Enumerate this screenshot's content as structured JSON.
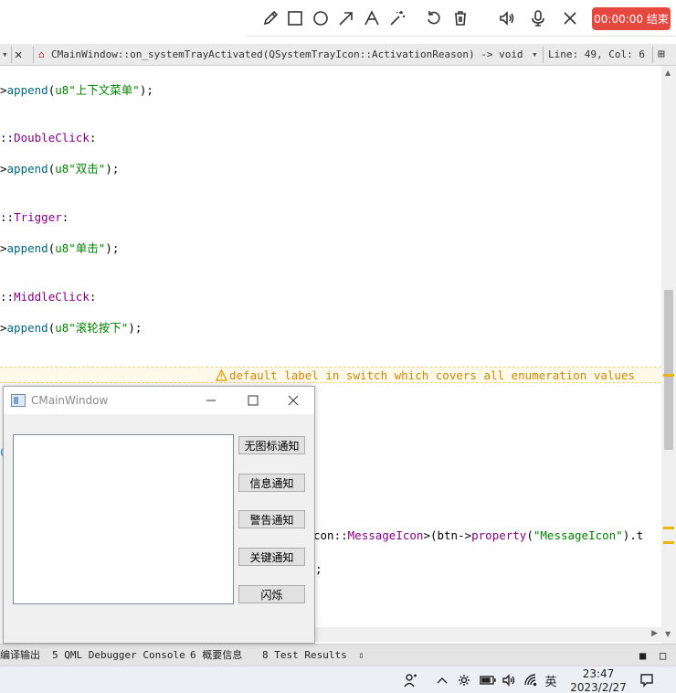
{
  "recorder": {
    "tools": [
      "pencil-icon",
      "rectangle-icon",
      "circle-icon",
      "arrow-icon",
      "text-icon",
      "magic-wand-icon",
      "undo-icon",
      "trash-icon",
      "speaker-icon",
      "microphone-icon",
      "close-icon"
    ],
    "timer_label": "00:00:00 结束",
    "timer_color": "#e5483f"
  },
  "editor_header": {
    "function_signature": "CMainWindow::on_systemTrayActivated(QSystemTrayIcon::ActivationReason) -> void",
    "cursor_position": "Line: 49, Col: 6"
  },
  "code": {
    "lines": [
      {
        "prefix": ">",
        "call": "append",
        "open": "(",
        "string": "u8\"上下文菜单\"",
        "close": ");"
      },
      {
        "scope": "::",
        "enum": "DoubleClick",
        "tail": ":"
      },
      {
        "prefix": ">",
        "call": "append",
        "open": "(",
        "string": "u8\"双击\"",
        "close": ");"
      },
      {
        "scope": "::",
        "enum": "Trigger",
        "tail": ":"
      },
      {
        "prefix": ">",
        "call": "append",
        "open": "(",
        "string": "u8\"单击\"",
        "close": ");"
      },
      {
        "scope": "::",
        "enum": "MiddleClick",
        "tail": ":"
      },
      {
        "prefix": ">",
        "call": "append",
        "open": "(",
        "string": "u8\"滚轮按下\"",
        "close": ");"
      }
    ],
    "warning": "default label in switch which covers all enumeration values",
    "partial_line": {
      "before": "con::",
      "enum": "MessageIcon",
      "mid": ">(btn->",
      "call": "property",
      "string": "\"MessageIcon\"",
      "after": ").t"
    },
    "partial_semicolon": ";"
  },
  "panel": {
    "tabs": [
      {
        "number": "",
        "label": "编译输出"
      },
      {
        "number": "5",
        "label": "QML Debugger Console"
      },
      {
        "number": "6",
        "label": "概要信息"
      },
      {
        "number": "8",
        "label": "Test Results"
      }
    ]
  },
  "qt_window": {
    "title": "CMainWindow",
    "buttons": [
      "无图标通知",
      "信息通知",
      "警告通知",
      "关键通知",
      "闪烁"
    ]
  },
  "taskbar": {
    "ime": "英",
    "time": "23:47",
    "date": "2023/2/27"
  },
  "colors": {
    "string": "#008000",
    "enum": "#800080",
    "function": "#00677c",
    "warning": "#c98a0a"
  }
}
